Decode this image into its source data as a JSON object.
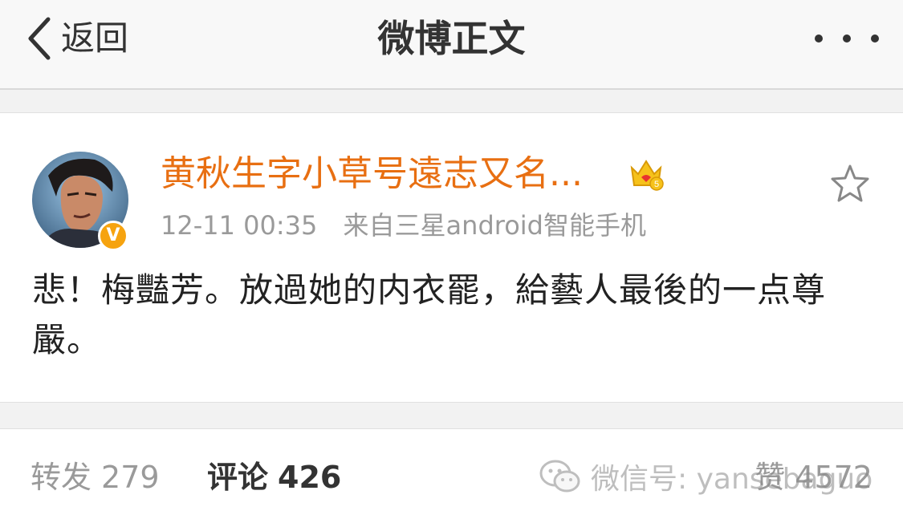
{
  "nav": {
    "back_label": "返回",
    "title": "微博正文",
    "more_icon": "more-horizontal-icon"
  },
  "post": {
    "username": "黄秋生字小草号遠志又名...",
    "time": "12-11 00:35",
    "source": "来自三星android智能手机",
    "text": "悲！梅豔芳。放過她的内衣罷，給藝人最後的一点尊嚴。",
    "verified_badge": "V",
    "accent_color": "#e86f12",
    "badge_color": "#f6a30f"
  },
  "tabs": {
    "repost_label": "转发",
    "repost_count": "279",
    "comment_label": "评论",
    "comment_count": "426",
    "like_label": "赞",
    "like_count": "4572"
  },
  "watermark": {
    "text": "微信号: yansebaguo"
  }
}
